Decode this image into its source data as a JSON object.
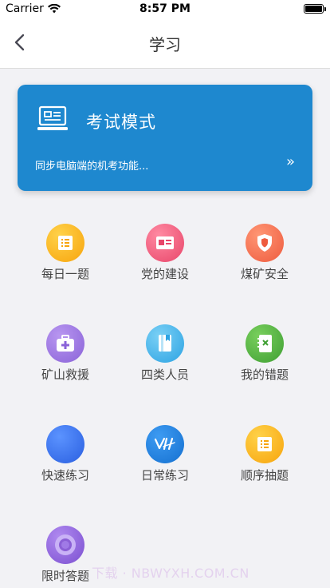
{
  "status": {
    "carrier": "Carrier",
    "time": "8:57 PM"
  },
  "nav": {
    "title": "学习"
  },
  "exam": {
    "title": "考试模式",
    "subtitle": "同步电脑端的机考功能...",
    "arrow": "»"
  },
  "tiles": [
    {
      "label": "每日一题",
      "icon": "list-icon",
      "color": "#f7b21a"
    },
    {
      "label": "党的建设",
      "icon": "party-flag-icon",
      "color": "#ef5a78"
    },
    {
      "label": "煤矿安全",
      "icon": "shield-icon",
      "color": "#f26a4f"
    },
    {
      "label": "矿山救援",
      "icon": "first-aid-kit-icon",
      "color": "#9b74e0"
    },
    {
      "label": "四类人员",
      "icon": "book-icon",
      "color": "#3fb1e8"
    },
    {
      "label": "我的错题",
      "icon": "wrong-notebook-icon",
      "color": "#4cae3e"
    },
    {
      "label": "快速练习",
      "icon": "blue-circle-icon",
      "color": "#3472f0"
    },
    {
      "label": "日常练习",
      "icon": "signature-icon",
      "color": "#1a7fe0"
    },
    {
      "label": "顺序抽题",
      "icon": "list-icon",
      "color": "#f7b21a"
    },
    {
      "label": "限时答题",
      "icon": "ring-timer-icon",
      "color": "#8b5fd6"
    }
  ],
  "watermark": "下载 · NBWYXH.COM.CN"
}
